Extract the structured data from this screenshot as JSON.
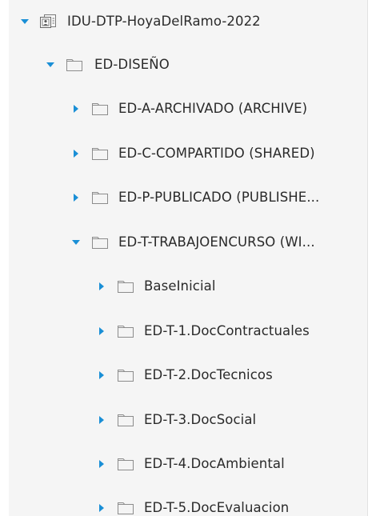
{
  "tree": {
    "root": {
      "label": "IDU-DTP-HoyaDelRamo-2022",
      "icon": "project-icon",
      "expanded": true
    },
    "folders": [
      {
        "key": "diseno",
        "label": "ED-DISEÑO",
        "level": 1,
        "expanded": true,
        "icon": "folder-icon"
      },
      {
        "key": "archivado",
        "label": "ED-A-ARCHIVADO (ARCHIVE)",
        "level": 2,
        "expanded": false,
        "icon": "folder-icon"
      },
      {
        "key": "compartido",
        "label": "ED-C-COMPARTIDO (SHARED)",
        "level": 2,
        "expanded": false,
        "icon": "folder-icon"
      },
      {
        "key": "publicado",
        "label": "ED-P-PUBLICADO (PUBLISHE...",
        "level": 2,
        "expanded": false,
        "icon": "folder-icon"
      },
      {
        "key": "trabajo",
        "label": "ED-T-TRABAJOENCURSO (WI...",
        "level": 2,
        "expanded": true,
        "icon": "folder-icon"
      },
      {
        "key": "baseinicial",
        "label": "BaseInicial",
        "level": 3,
        "expanded": false,
        "icon": "folder-icon"
      },
      {
        "key": "doccontractuales",
        "label": "ED-T-1.DocContractuales",
        "level": 3,
        "expanded": false,
        "icon": "folder-icon"
      },
      {
        "key": "doctecnicos",
        "label": "ED-T-2.DocTecnicos",
        "level": 3,
        "expanded": false,
        "icon": "folder-icon"
      },
      {
        "key": "docsocial",
        "label": "ED-T-3.DocSocial",
        "level": 3,
        "expanded": false,
        "icon": "folder-icon"
      },
      {
        "key": "docambiental",
        "label": "ED-T-4.DocAmbiental",
        "level": 3,
        "expanded": false,
        "icon": "folder-icon"
      },
      {
        "key": "docevaluacion",
        "label": "ED-T-5.DocEvaluacion",
        "level": 3,
        "expanded": false,
        "icon": "folder-icon"
      }
    ]
  },
  "colors": {
    "panel_background": "#f5f5f5",
    "caret": "#1a8fd6",
    "folder_fill": "#f4f4f4",
    "folder_stroke": "#8c8c8c",
    "label_text": "#2a2a2a"
  }
}
